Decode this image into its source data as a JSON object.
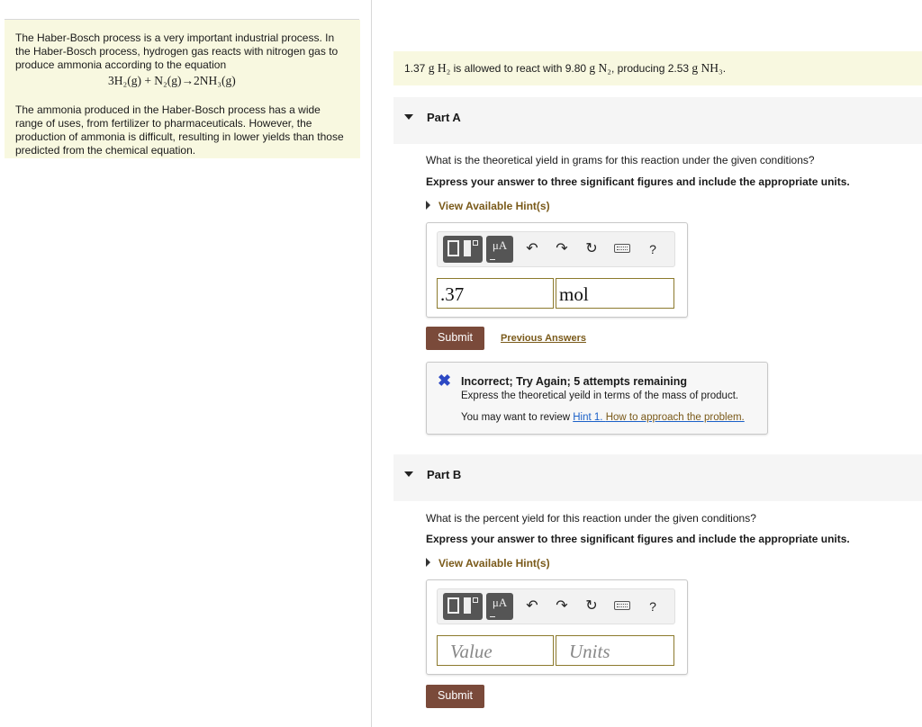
{
  "intro": {
    "paragraph1": "The Haber-Bosch process is a very important industrial process. In the Haber-Bosch process, hydrogen gas reacts with nitrogen gas to produce ammonia according to the equation",
    "equation": "3H₂(g) + N₂(g)→2NH₃(g)",
    "paragraph2": "The ammonia produced in the Haber-Bosch process has a wide range of uses, from fertilizer to pharmaceuticals. However, the production of ammonia is difficult, resulting in lower yields than those predicted from the chemical equation."
  },
  "given": {
    "part1": "1.37",
    "unit1": "g H₂",
    "part2": "is allowed to react with 9.80",
    "unit2": "g N₂",
    "part3": ", producing 2.53",
    "unit3": "g NH₃",
    "part4": "."
  },
  "partA": {
    "label": "Part A",
    "question": "What is the theoretical yield in grams for this reaction under the given conditions?",
    "instruction": "Express your answer to three significant figures and include the appropriate units.",
    "hints_label": "View Available Hint(s)",
    "toolbar": {
      "mu_label": "μA",
      "help_label": "?"
    },
    "value": ".37",
    "units": "mol",
    "submit_label": "Submit",
    "previous_answers_label": "Previous Answers",
    "feedback": {
      "title": "Incorrect; Try Again; 5 attempts remaining",
      "message": "Express the theoretical yeild in terms of the mass of product.",
      "review_prefix": "You may want to review",
      "hint_link_part1": "Hint 1.",
      "hint_link_part2": "How to approach the problem."
    }
  },
  "partB": {
    "label": "Part B",
    "question": "What is the percent yield for this reaction under the given conditions?",
    "instruction": "Express your answer to three significant figures and include the appropriate units.",
    "hints_label": "View Available Hint(s)",
    "toolbar": {
      "mu_label": "μA",
      "help_label": "?"
    },
    "value_placeholder": "Value",
    "units_placeholder": "Units",
    "submit_label": "Submit"
  }
}
